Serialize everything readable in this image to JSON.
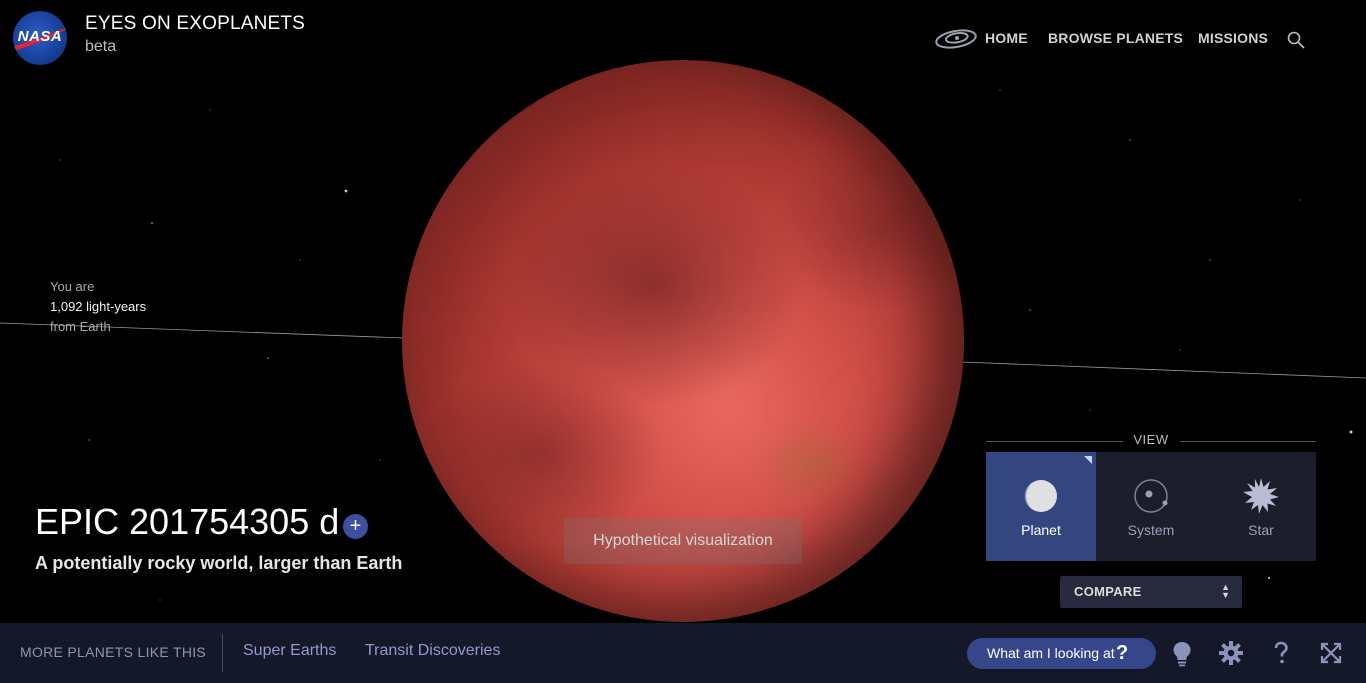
{
  "header": {
    "logo_text": "NASA",
    "title": "EYES ON EXOPLANETS",
    "subtitle": "beta"
  },
  "nav": {
    "home": "HOME",
    "browse": "BROWSE PLANETS",
    "missions": "MISSIONS",
    "search_icon": "search-icon",
    "galaxy_icon": "galaxy-icon"
  },
  "distance": {
    "line1": "You are",
    "line2": "1,092 light-years",
    "line3": "from Earth"
  },
  "planet": {
    "name": "EPIC 201754305 d",
    "add_symbol": "+",
    "description": "A potentially rocky world, larger than Earth",
    "visualization_note": "Hypothetical visualization"
  },
  "view": {
    "label": "VIEW",
    "options": [
      {
        "label": "Planet",
        "icon": "planet-icon",
        "active": true
      },
      {
        "label": "System",
        "icon": "system-icon",
        "active": false
      },
      {
        "label": "Star",
        "icon": "star-icon",
        "active": false
      }
    ],
    "compare": "COMPARE"
  },
  "bottom_bar": {
    "more_label": "MORE PLANETS LIKE THIS",
    "chips": [
      "Super Earths",
      "Transit Discoveries"
    ],
    "what_am_i": "What am I looking at",
    "what_am_i_q": "?",
    "tools": [
      "lightbulb-icon",
      "gear-icon",
      "help-icon",
      "fullscreen-icon"
    ]
  },
  "colors": {
    "active_view": "#33467f",
    "bottom_bar": "#151828",
    "accent_button": "#36468a",
    "planet": "#cf4d47"
  }
}
